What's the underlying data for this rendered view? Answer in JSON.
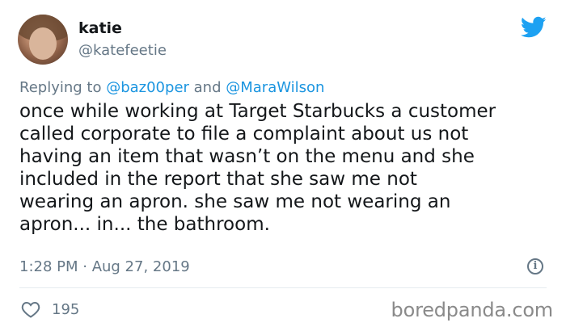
{
  "tweet": {
    "author": {
      "display_name": "katie",
      "handle": "@katefeetie"
    },
    "replying": {
      "prefix": "Replying to ",
      "mention_1": "@baz00per",
      "joiner": " and ",
      "mention_2": "@MaraWilson"
    },
    "text_lines": [
      "once while working at Target Starbucks a customer",
      "called corporate to file a complaint about us not",
      "having an item that wasn’t on the menu and she",
      "included in the report that she saw me not",
      "wearing an apron. she saw me not wearing an",
      "apron... in... the bathroom."
    ],
    "timestamp": "1:28 PM · Aug 27, 2019",
    "info_glyph": "i",
    "likes": "195"
  },
  "watermark": "boredpanda.com",
  "colors": {
    "twitter_blue": "#1da1f2",
    "mention_blue": "#1b95e0",
    "secondary_text": "#657786",
    "primary_text": "#14171a"
  },
  "icons": {
    "logo": "twitter-bird-icon",
    "info": "info-icon",
    "like": "heart-icon"
  }
}
